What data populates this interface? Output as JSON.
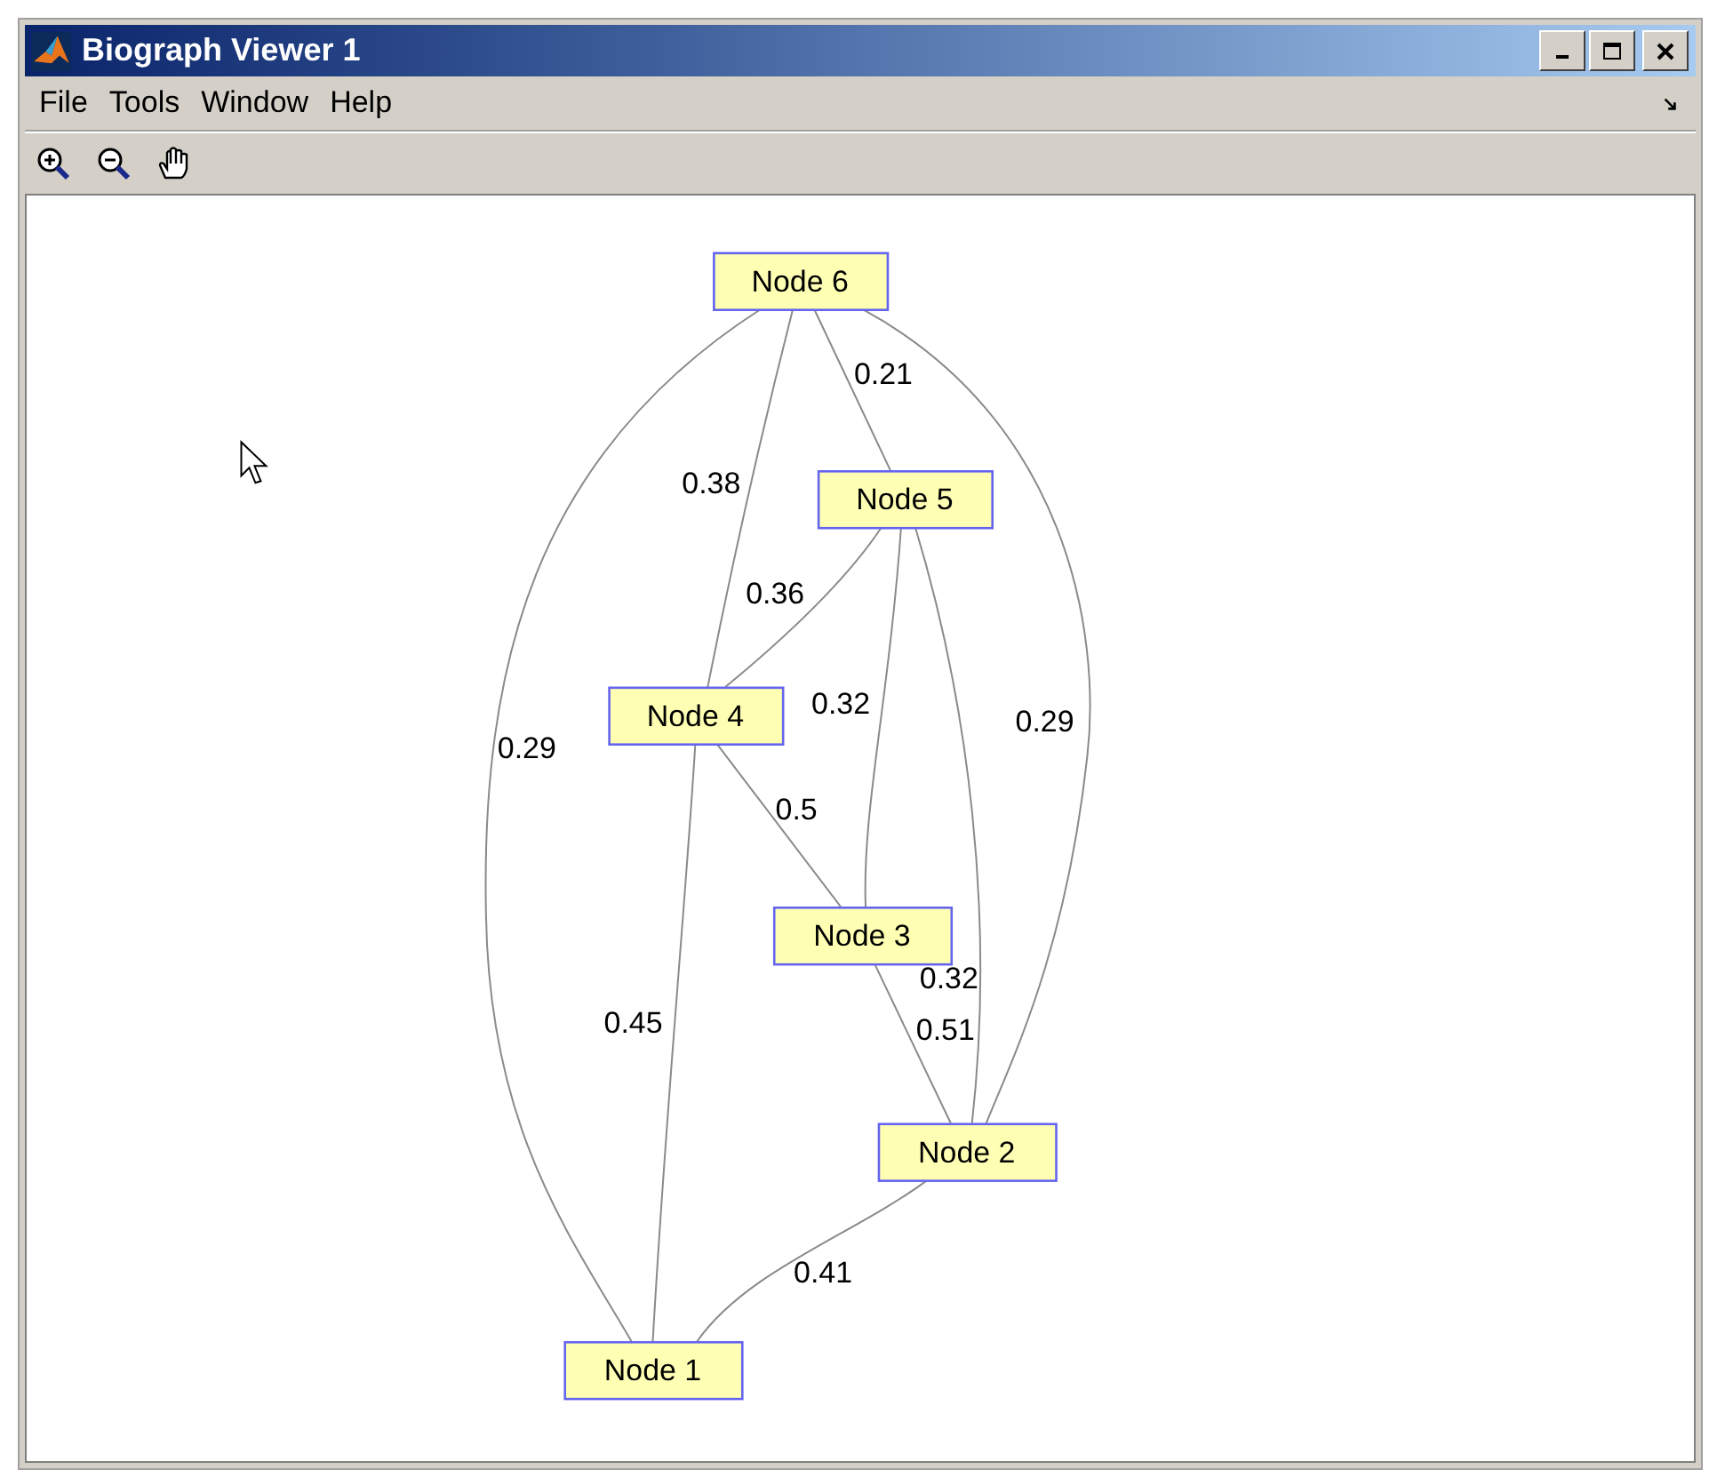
{
  "window": {
    "title": "Biograph Viewer 1"
  },
  "menu": [
    "File",
    "Tools",
    "Window",
    "Help"
  ],
  "toolbar": [
    {
      "kind": "zoom-in"
    },
    {
      "kind": "zoom-out"
    },
    {
      "kind": "pan"
    }
  ],
  "graph": {
    "nodes": [
      "Node 1",
      "Node 2",
      "Node 3",
      "Node 4",
      "Node 5",
      "Node 6"
    ],
    "edges": [
      {
        "label": "0.29"
      },
      {
        "label": "0.38"
      },
      {
        "label": "0.21"
      },
      {
        "label": "0.29"
      },
      {
        "label": "0.36"
      },
      {
        "label": "0.32"
      },
      {
        "label": "0.32"
      },
      {
        "label": "0.5"
      },
      {
        "label": "0.45"
      },
      {
        "label": "0.51"
      },
      {
        "label": "0.41"
      }
    ]
  }
}
